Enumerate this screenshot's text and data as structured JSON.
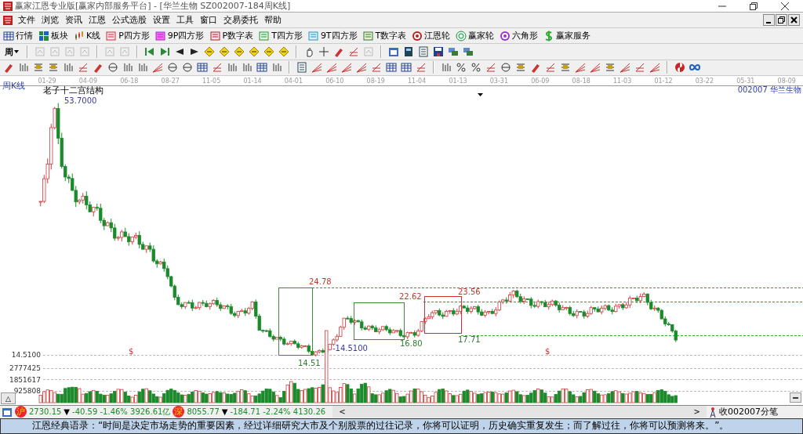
{
  "window": {
    "title": "赢家江恩专业版[赢家内部服务平台] - [华兰生物  SZ002007-184周K线]"
  },
  "menu": [
    "文件",
    "浏览",
    "资讯",
    "江恩",
    "公式选股",
    "设置",
    "工具",
    "窗口",
    "交易委托",
    "帮助"
  ],
  "toolbar": [
    "行情",
    "板块",
    "K线",
    "P四方形",
    "9P四方形",
    "P数字表",
    "T四方形",
    "9T四方形",
    "T数字表",
    "江恩轮",
    "赢家轮",
    "六角形",
    "赢家服务"
  ],
  "period_select": {
    "value": "周"
  },
  "chart": {
    "period_label": "周K线",
    "title": "老子十二宫结构",
    "stock": "002007 华兰生物",
    "dates": [
      "01-29",
      "04-09",
      "06-18",
      "08-27",
      "11-05",
      "01-14",
      "04-01",
      "06-10",
      "08-19",
      "11-04",
      "01-13",
      "03-31",
      "06-09",
      "08-18",
      "11-03",
      "01-12",
      "03-22",
      "05-31",
      "08-09"
    ],
    "price_axis": [
      "14.5100"
    ],
    "volume_axis": [
      "2777425",
      "1851617",
      "925808"
    ],
    "annotations": [
      {
        "text": "53.7000",
        "color": "#3a3aa0"
      },
      {
        "text": "24.78",
        "color": "#c0392b"
      },
      {
        "text": "22.62",
        "color": "#c0392b"
      },
      {
        "text": "23.56",
        "color": "#c0392b"
      },
      {
        "text": "16.80",
        "color": "#2e7d32"
      },
      {
        "text": "17.71",
        "color": "#2e7d32"
      },
      {
        "text": "-14.5100",
        "color": "#3a3aa0"
      },
      {
        "text": "14.51",
        "color": "#2e7d32"
      }
    ],
    "markers": [
      "$",
      "$"
    ],
    "collapse_button": "△"
  },
  "index_bar": [
    {
      "badge": "沪",
      "price": "2730.15",
      "arrow": "▼",
      "change": "-40.59 -1.46% 3926.61亿"
    },
    {
      "badge": "深",
      "price": "8055.77",
      "arrow": "▼",
      "change": "-184.71 -2.24% 4130.26"
    }
  ],
  "scroll": {
    "left": "<",
    "right": ">"
  },
  "status_right": "收002007分笔",
  "marquee": "江恩经典语录：“时间是决定市场走势的重要因素，经过详细研究大市及个别股票的过往记录，你将可以证明，历史确实重复发生；而了解过往，你将可以预测将来。”。"
}
